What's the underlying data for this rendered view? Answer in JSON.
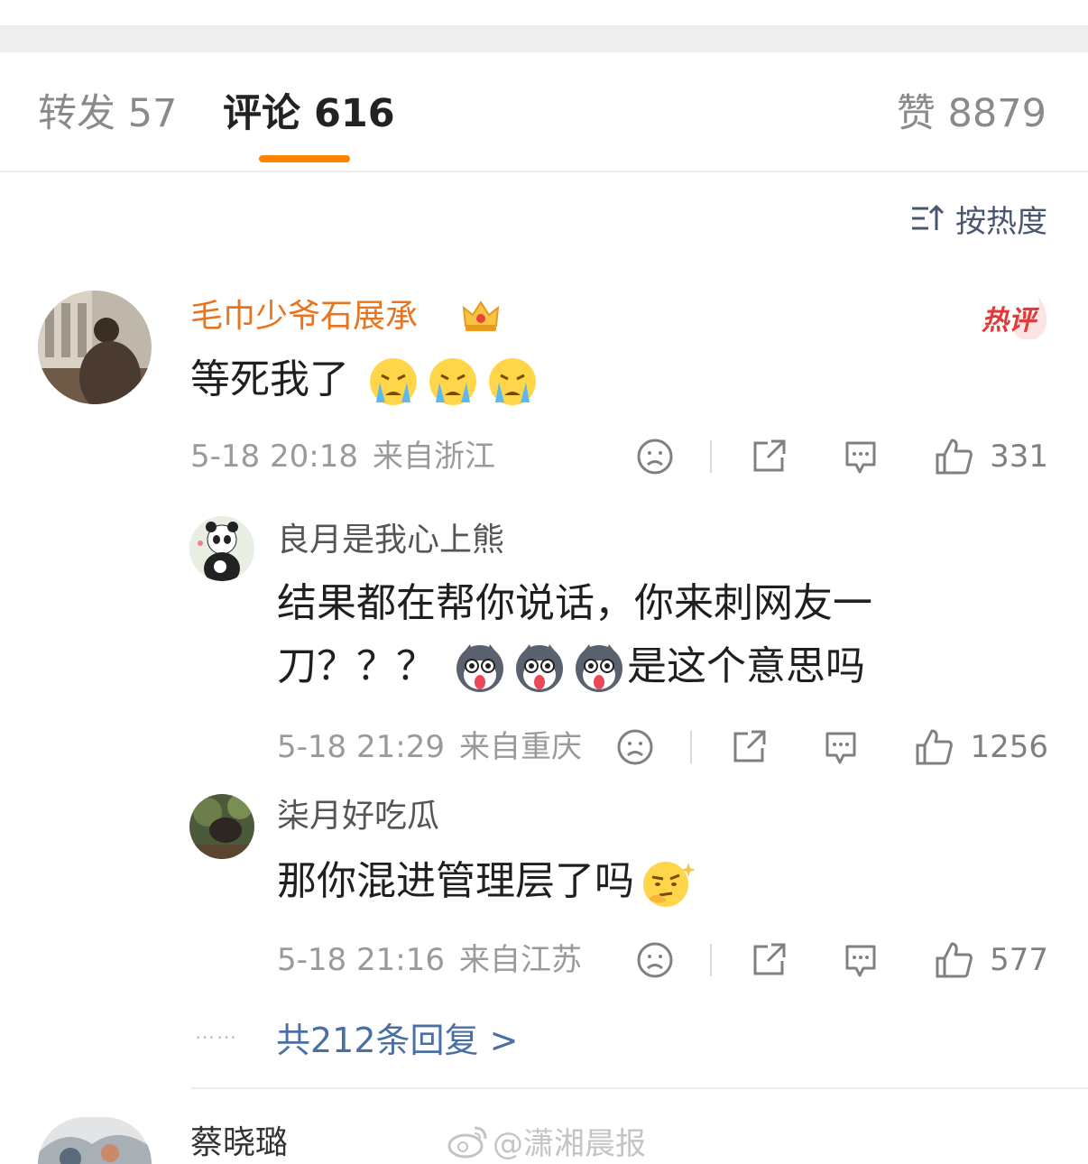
{
  "tabs": {
    "repost": "转发 57",
    "comment": "评论 616",
    "like": "赞 8879"
  },
  "sort": {
    "label": "按热度"
  },
  "main_comment": {
    "author": "毛巾少爷石展承",
    "badge": "热评",
    "text": "等死我了",
    "emojis": [
      "crying-emoji",
      "crying-emoji",
      "crying-emoji"
    ],
    "date": "5-18 20:18",
    "location": "来自浙江",
    "likes": "331"
  },
  "replies": [
    {
      "author": "良月是我心上熊",
      "text_line1": "结果都在帮你说话，你来刺网友一",
      "text_line2_prefix": "刀？？？",
      "text_line2_suffix": "是这个意思吗",
      "emojis": [
        "husky-emoji",
        "husky-emoji",
        "husky-emoji"
      ],
      "date": "5-18 21:29",
      "location": "来自重庆",
      "likes": "1256"
    },
    {
      "author": "柒月好吃瓜",
      "text": "那你混进管理层了吗",
      "emojis": [
        "thinking-emoji"
      ],
      "date": "5-18 21:16",
      "location": "来自江苏",
      "likes": "577"
    }
  ],
  "more_replies": {
    "dots": "……",
    "label": "共212条回复 >"
  },
  "next_comment": {
    "author": "蔡晓璐"
  },
  "watermark": "@潇湘晨报",
  "colors": {
    "accent": "#ff8200",
    "link": "#4a6fa5",
    "hot_author": "#e8741e"
  }
}
